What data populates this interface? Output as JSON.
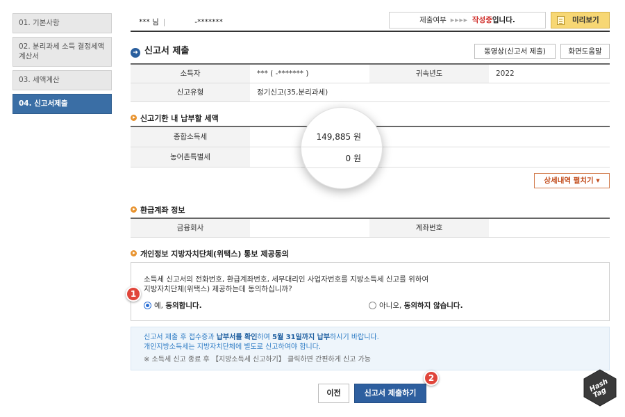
{
  "sidebar": {
    "items": [
      {
        "label": "01. 기본사항"
      },
      {
        "label": "02. 분리과세 소득 결정세액 계산서"
      },
      {
        "label": "03. 세액계산"
      },
      {
        "label": "04. 신고서제출"
      }
    ]
  },
  "topbar": {
    "user_name": "*** 님",
    "user_id": "-*******",
    "status_label": "제출여부",
    "status_arrows": "▸▸▸▸",
    "status_value": "작성중",
    "status_suffix": "입니다.",
    "preview_label": "미리보기"
  },
  "section": {
    "title": "신고서 제출",
    "video_button": "동영상(신고서 제출)",
    "help_button": "화면도움말"
  },
  "info_table": {
    "taxpayer_label": "소득자",
    "taxpayer_value": "***  (             -*******  )",
    "year_label": "귀속년도",
    "year_value": "2022",
    "type_label": "신고유형",
    "type_value": "정기신고(35,분리과세)"
  },
  "payment": {
    "title": "신고기한 내 납부할 세액",
    "income_tax_label": "종합소득세",
    "income_tax_value": "149,885 원",
    "rural_tax_label": "농어촌특별세",
    "rural_tax_value": "0 원",
    "detail_button": "상세내역 펼치기 ▾"
  },
  "refund": {
    "title": "환급계좌 정보",
    "bank_label": "금융회사",
    "bank_value": "",
    "account_label": "계좌번호",
    "account_value": ""
  },
  "consent": {
    "title": "개인정보 지방자치단체(위택스) 통보 제공동의",
    "message_line1": "소득세 신고서의 전화번호, 환급계좌번호, 세무대리인 사업자번호를 지방소득세 신고를 위하여",
    "message_line2": "지방자치단체(위택스) 제공하는데 동의하십니까?",
    "yes_prefix": "예, ",
    "yes_bold": "동의합니다.",
    "no_prefix": "아니오, ",
    "no_bold": "동의하지 않습니다.",
    "selected": "yes"
  },
  "notice": {
    "line1_a": "신고서 제출 후 접수증과 ",
    "line1_b": "납부서를 확인",
    "line1_c": "하여 ",
    "line1_d": "5월 31일까지 납부",
    "line1_e": "하시기 바랍니다.",
    "line2": "개인지방소득세는 지방자치단체에 별도로 신고하여야 합니다.",
    "line3": "※ 소득세 신고 종료 후 【지방소득세 신고하기】 클릭하면 간편하게 신고 가능"
  },
  "buttons": {
    "prev": "이전",
    "submit": "신고서 제출하기"
  },
  "badges": {
    "one": "1",
    "two": "2"
  },
  "watermark": {
    "text1": "Hash",
    "text2": "Tag"
  },
  "colors": {
    "accent_blue": "#2e5f9f",
    "status_red": "#d0312d",
    "preview_yellow": "#f7d774",
    "badge_red": "#e0453a",
    "bullet_orange": "#e8932e"
  }
}
